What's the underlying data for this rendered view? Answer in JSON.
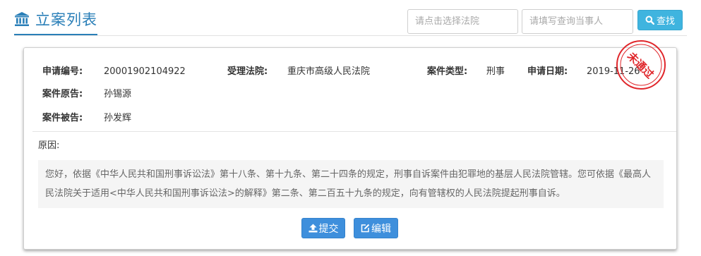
{
  "header": {
    "title": "立案列表",
    "court_placeholder": "请点击选择法院",
    "party_placeholder": "请填写查询当事人",
    "search_label": "查找"
  },
  "case": {
    "application_no_label": "申请编号:",
    "application_no": "20001902104922",
    "court_label": "受理法院:",
    "court": "重庆市高级人民法院",
    "type_label": "案件类型:",
    "type": "刑事",
    "date_label": "申请日期:",
    "date": "2019-11-26",
    "plaintiff_label": "案件原告:",
    "plaintiff": "孙锡源",
    "defendant_label": "案件被告:",
    "defendant": "孙发辉",
    "reason_label": "原因:",
    "reason_text": "您好，依据《中华人民共和国刑事诉讼法》第十八条、第十九条、第二十四条的规定，刑事自诉案件由犯罪地的基层人民法院管辖。您可依据《最高人民法院关于适用<中华人民共和国刑事诉讼法>的解释》第二条、第二百五十九条的规定，向有管辖权的人民法院提起刑事自诉。",
    "stamp_text": "未通过",
    "stamp_color": "#e0262b",
    "submit_label": "提交",
    "edit_label": "编辑"
  },
  "colors": {
    "accent": "#2a7fb8",
    "search_button": "#3fb4df",
    "action_button": "#3e8fdc"
  },
  "icons": {
    "title": "bank-icon",
    "search": "search-icon",
    "submit": "upload-icon",
    "edit": "edit-icon"
  }
}
